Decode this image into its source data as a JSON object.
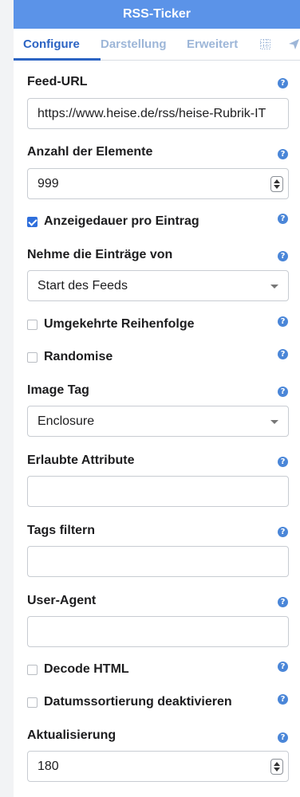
{
  "window": {
    "title": "RSS-Ticker"
  },
  "tabs": [
    {
      "label": "Configure"
    },
    {
      "label": "Darstellung"
    },
    {
      "label": "Erweitert"
    }
  ],
  "tab_icons": [
    "grid-icon",
    "send-icon"
  ],
  "help_glyph": "?",
  "fields": {
    "feed_url": {
      "label": "Feed-URL",
      "value": "https://www.heise.de/rss/heise-Rubrik-IT"
    },
    "item_count": {
      "label": "Anzahl der Elemente",
      "value": "999"
    },
    "display_duration": {
      "label": "Anzeigedauer pro Eintrag",
      "checked": true
    },
    "take_entries_from": {
      "label": "Nehme die Einträge von",
      "value": "Start des Feeds"
    },
    "reverse_order": {
      "label": "Umgekehrte Reihenfolge",
      "checked": false
    },
    "randomise": {
      "label": "Randomise",
      "checked": false
    },
    "image_tag": {
      "label": "Image Tag",
      "value": "Enclosure"
    },
    "allowed_attributes": {
      "label": "Erlaubte Attribute",
      "value": ""
    },
    "filter_tags": {
      "label": "Tags filtern",
      "value": ""
    },
    "user_agent": {
      "label": "User-Agent",
      "value": ""
    },
    "decode_html": {
      "label": "Decode HTML",
      "checked": false
    },
    "disable_date_sort": {
      "label": "Datumssortierung deaktivieren",
      "checked": false
    },
    "refresh": {
      "label": "Aktualisierung",
      "value": "180"
    }
  },
  "colors": {
    "title_bar": "#5b93e8",
    "active_tab": "#2b63c3",
    "inactive_tab": "#9db6d8",
    "help_icon": "#4a86d8",
    "checkbox_checked": "#2f6fdc"
  }
}
